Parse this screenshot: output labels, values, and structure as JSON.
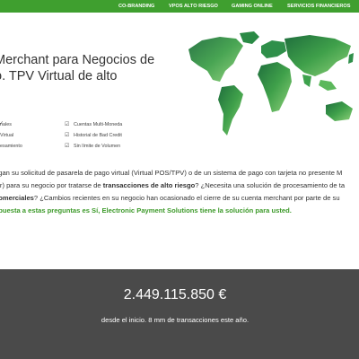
{
  "nav": {
    "items": [
      "CO-BRANDING",
      "VPOS ALTO RIESGO",
      "GAMING ONLINE",
      "SERVICIOS FINANCIEROS"
    ]
  },
  "hero": {
    "title_line1": "Merchant para Negocios de",
    "title_line2": "o. TPV Virtual de alto"
  },
  "features": {
    "left": [
      "nales",
      "Virtual",
      "esamiento"
    ],
    "right": [
      "Cuentas Multi-Moneda",
      "Historial de Bad Credit",
      "Sin límite de Volumen"
    ]
  },
  "body": {
    "p1": "egan su solicitud de pasarela de pago virtual (Virtual POS/TPV) o de un sistema de pago con tarjeta no presente M",
    "p2_pre": "ler) para su negocio por tratarse de ",
    "p2_bold": "transacciones de alto riesgo",
    "p2_post": "? ¿Necesita una solución de procesamiento de ta",
    "p3_bold": "comerciales",
    "p3_post": "? ¿Cambios recientes en su negocio han ocasionado el cierre de su cuenta merchant por parte de su",
    "p4": "spuesta a estas preguntas es Sí, Electronic Payment Solutions tiene la solución para usted."
  },
  "stats": {
    "amount": "2.449.115.850 €",
    "since": "desde el inicio. 8 mm de transacciones este año."
  },
  "colors": {
    "accent": "#3f9f2f",
    "footer_bg": "#4a4a4a",
    "map_dark": "#1f6e3d",
    "map_light": "#8fd17a"
  }
}
